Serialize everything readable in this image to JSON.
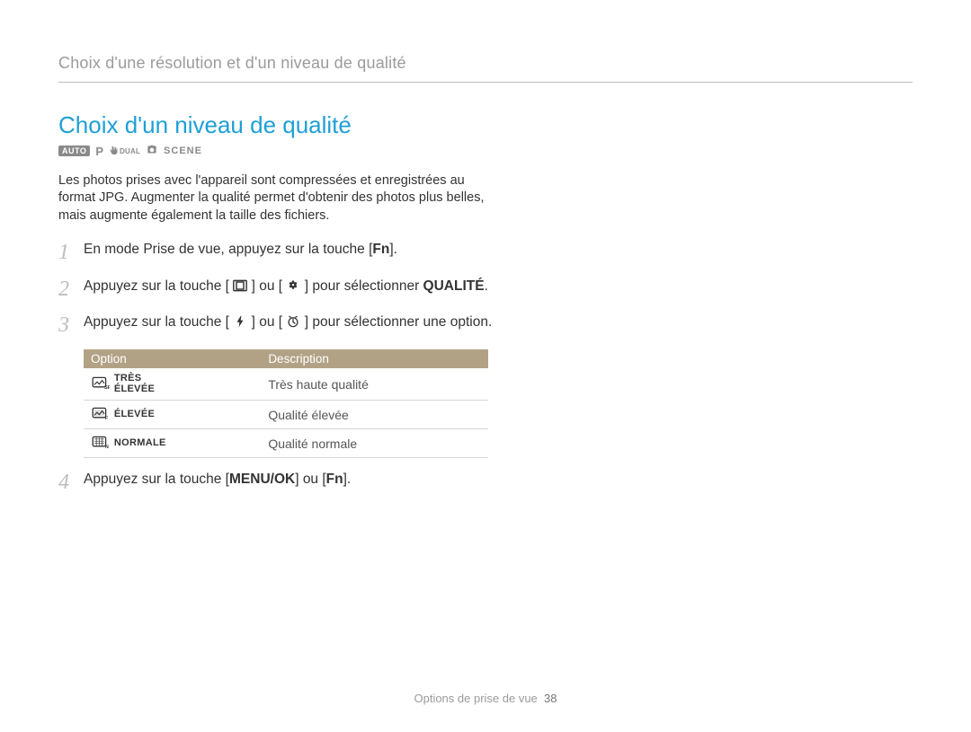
{
  "runningHead": "Choix d'une résolution et d'un niveau de qualité",
  "sectionTitle": "Choix d'un niveau de qualité",
  "modeIcons": {
    "auto": "AUTO",
    "p": "P",
    "dual": "DUAL",
    "scene": "SCENE"
  },
  "intro": "Les photos prises avec l'appareil sont compressées et enregistrées au format JPG. Augmenter la qualité permet d'obtenir des photos plus belles, mais augmente également la taille des fichiers.",
  "steps": {
    "s1": {
      "num": "1",
      "a": "En mode Prise de vue, appuyez sur la touche [",
      "fn": "Fn",
      "b": "]."
    },
    "s2": {
      "num": "2",
      "a": "Appuyez sur la touche [",
      "b": "] ou [",
      "c": "] pour sélectionner ",
      "qualite": "QUALITÉ",
      "d": "."
    },
    "s3": {
      "num": "3",
      "a": "Appuyez sur la touche [",
      "b": "] ou [",
      "c": "] pour sélectionner une option."
    },
    "s4": {
      "num": "4",
      "a": "Appuyez sur la touche [",
      "menu": "MENU/OK",
      "b": "] ou [",
      "fn": "Fn",
      "c": "]."
    }
  },
  "table": {
    "headers": {
      "option": "Option",
      "description": "Description"
    },
    "rows": [
      {
        "iconSub": "SF",
        "label": "TRÈS ÉLEVÉE",
        "labelL1": "TRÈS",
        "labelL2": "ÉLEVÉE",
        "desc": "Très haute qualité"
      },
      {
        "iconSub": "F",
        "label": "ÉLEVÉE",
        "labelL1": "ÉLEVÉE",
        "labelL2": "",
        "desc": "Qualité élevée"
      },
      {
        "iconSub": "N",
        "label": "NORMALE",
        "labelL1": "NORMALE",
        "labelL2": "",
        "desc": "Qualité normale"
      }
    ]
  },
  "footer": {
    "section": "Options de prise de vue",
    "page": "38"
  }
}
